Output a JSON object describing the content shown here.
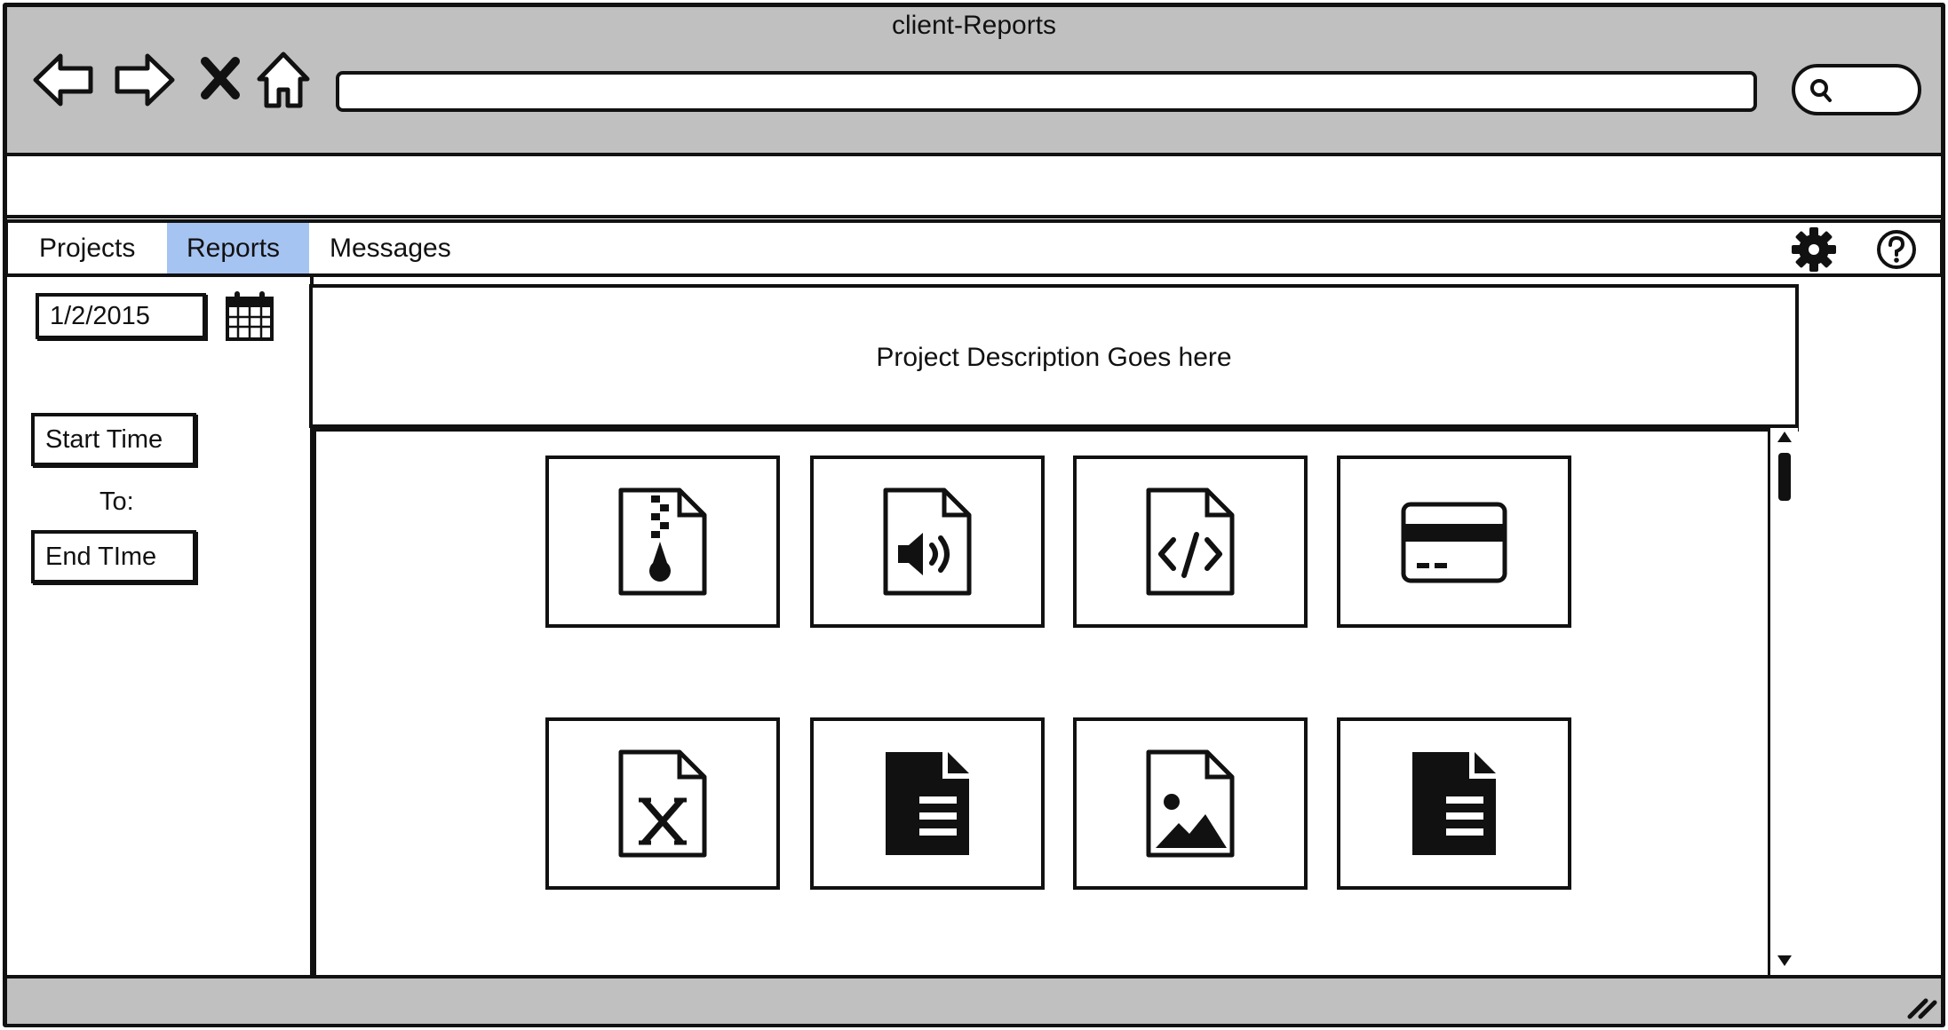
{
  "window": {
    "title": "client-Reports"
  },
  "browser": {
    "nav_icons": [
      "back-icon",
      "forward-icon",
      "stop-icon",
      "home-icon"
    ],
    "address_value": "",
    "search_icon": "search-icon"
  },
  "tabs": [
    {
      "label": "Projects",
      "selected": false
    },
    {
      "label": "Reports",
      "selected": true
    },
    {
      "label": "Messages",
      "selected": false
    }
  ],
  "toolbar_icons": [
    "gear-icon",
    "help-icon"
  ],
  "colors": {
    "chrome": "#c0c0c0",
    "selected_tab": "#a6c4f2",
    "ink": "#111111"
  },
  "sidebar": {
    "date_value": "1/2/2015",
    "calendar_icon": "calendar-icon",
    "start_time": "Start Time",
    "to_label": "To:",
    "end_time": "End TIme"
  },
  "main": {
    "description": "Project Description Goes here",
    "tiles": [
      {
        "icon": "zip-file-icon"
      },
      {
        "icon": "audio-file-icon"
      },
      {
        "icon": "code-file-icon"
      },
      {
        "icon": "credit-card-icon"
      },
      {
        "icon": "excel-file-icon"
      },
      {
        "icon": "document-file-icon"
      },
      {
        "icon": "image-file-icon"
      },
      {
        "icon": "document-file-icon"
      }
    ]
  }
}
